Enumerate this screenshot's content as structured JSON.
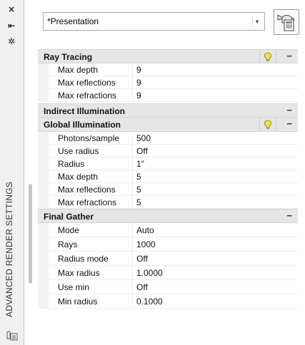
{
  "palette": {
    "title": "ADVANCED RENDER SETTINGS",
    "close_glyph": "×",
    "pin_glyph": "⇤",
    "properties_glyph": "✲"
  },
  "preset": {
    "value": "*Presentation"
  },
  "render_button": {
    "icon": "render-teapot-icon"
  },
  "sections": [
    {
      "title": "Ray Tracing",
      "has_bulb": true,
      "rows": [
        {
          "name": "Max depth",
          "value": "9"
        },
        {
          "name": "Max reflections",
          "value": "9"
        },
        {
          "name": "Max refractions",
          "value": "9"
        }
      ]
    },
    {
      "title": "Indirect Illumination",
      "has_bulb": false,
      "rows": []
    },
    {
      "title": "Global Illumination",
      "has_bulb": true,
      "rows": [
        {
          "name": "Photons/sample",
          "value": "500"
        },
        {
          "name": "Use radius",
          "value": "Off"
        },
        {
          "name": "Radius",
          "value": "1\""
        },
        {
          "name": "Max depth",
          "value": "5"
        },
        {
          "name": "Max reflections",
          "value": "5"
        },
        {
          "name": "Max refractions",
          "value": "5"
        }
      ]
    },
    {
      "title": "Final Gather",
      "has_bulb": false,
      "rows": [
        {
          "name": "Mode",
          "value": "Auto"
        },
        {
          "name": "Rays",
          "value": "1000"
        },
        {
          "name": "Radius mode",
          "value": "Off"
        },
        {
          "name": "Max radius",
          "value": "1.0000"
        },
        {
          "name": "Use min",
          "value": "Off"
        },
        {
          "name": "Min radius",
          "value": "0.1000"
        }
      ]
    }
  ],
  "collapse_glyph": "−"
}
